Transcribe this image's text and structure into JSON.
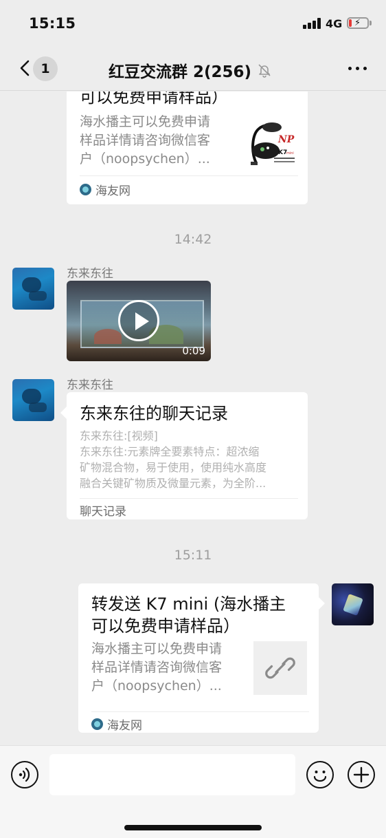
{
  "status_bar": {
    "time": "15:15",
    "network": "4G"
  },
  "nav": {
    "back_unread_count": "1",
    "title": "红豆交流群 2(256)"
  },
  "messages": {
    "top_card": {
      "title_tail": "可以免费申请样品）",
      "desc": [
        "海水播主可以免费申请",
        "样品详情请咨询微信客",
        "户（noopsychen）..."
      ],
      "source": "海友网",
      "thumb": {
        "brand": "NP",
        "model": "K7",
        "model_suffix": "mini"
      }
    },
    "time1": "14:42",
    "video_msg": {
      "sender": "东来东往",
      "duration": "0:09"
    },
    "record_msg": {
      "sender": "东来东往",
      "title": "东来东往的聊天记录",
      "lines": [
        "东来东往:[视频]",
        "东来东往:元素牌全要素特点：超浓缩",
        "矿物混合物，易于使用，使用纯水高度",
        "融合关键矿物质及微量元素，为全阶..."
      ],
      "footer": "聊天记录"
    },
    "time2": "15:11",
    "self_card": {
      "title": [
        "转发送 K7 mini (海水播主",
        "可以免费申请样品）"
      ],
      "desc": [
        "海水播主可以免费申请",
        "样品详情请咨询微信客",
        "户（noopsychen）..."
      ],
      "source": "海友网"
    }
  },
  "input": {
    "placeholder": ""
  }
}
